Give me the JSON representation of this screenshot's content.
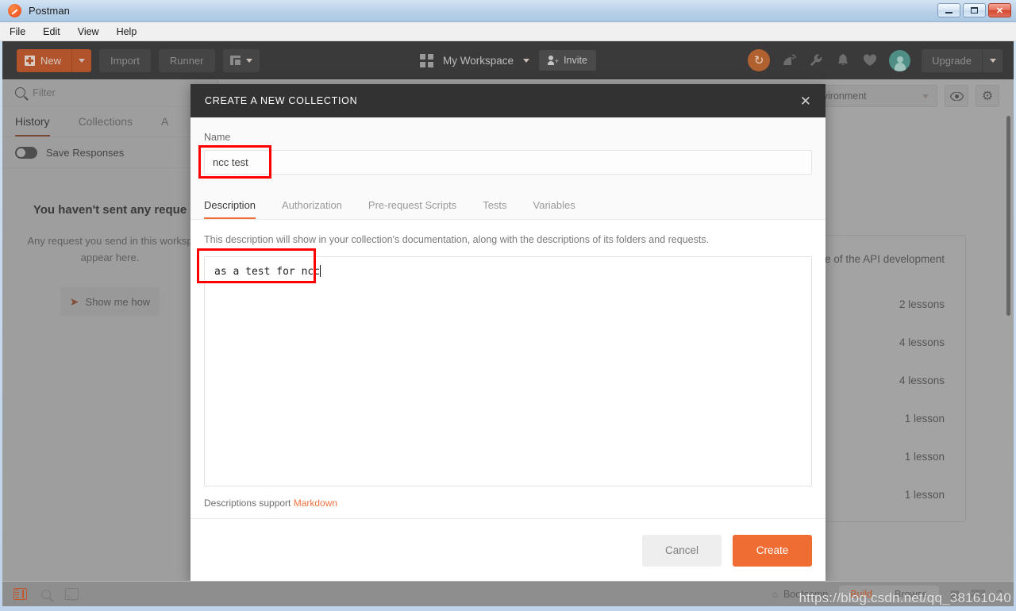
{
  "window": {
    "title": "Postman",
    "minimize_label": "—",
    "maximize_label": "□",
    "close_label": "✕"
  },
  "menubar": {
    "items": [
      "File",
      "Edit",
      "View",
      "Help"
    ]
  },
  "toolbar": {
    "new_label": "New",
    "import_label": "Import",
    "runner_label": "Runner",
    "workspace_label": "My Workspace",
    "invite_label": "Invite",
    "upgrade_label": "Upgrade",
    "icons": [
      "sync-icon",
      "broadcast-icon",
      "wrench-icon",
      "bell-icon",
      "heart-icon",
      "avatar-icon"
    ],
    "sync_glyph": "↻"
  },
  "sidebar": {
    "filter_placeholder": "Filter",
    "tabs": [
      {
        "label": "History",
        "active": true
      },
      {
        "label": "Collections",
        "active": false
      },
      {
        "label": "A",
        "active": false
      }
    ],
    "save_responses_label": "Save Responses",
    "empty_title": "You haven't sent any reque",
    "empty_sub_line1": "Any request you send in this worksp",
    "empty_sub_line2": "appear here.",
    "show_me_how_label": "Show me how",
    "cursor_glyph": "➤"
  },
  "right_pane": {
    "environment_selected": "No Environment",
    "environment_visible_text": "nment",
    "eye_glyph": "◉",
    "gear_glyph": "⚙",
    "card_line": "stage of the API development",
    "lessons": [
      "2 lessons",
      "4 lessons",
      "4 lessons",
      "1 lesson",
      "1 lesson",
      "1 lesson"
    ]
  },
  "modal": {
    "title": "CREATE A NEW COLLECTION",
    "close_glyph": "✕",
    "name_label": "Name",
    "name_value": "ncc test",
    "tabs": [
      {
        "label": "Description",
        "active": true
      },
      {
        "label": "Authorization",
        "active": false
      },
      {
        "label": "Pre-request Scripts",
        "active": false
      },
      {
        "label": "Tests",
        "active": false
      },
      {
        "label": "Variables",
        "active": false
      }
    ],
    "description_hint": "This description will show in your collection's documentation, along with the descriptions of its folders and requests.",
    "description_value": "as a test for ncc",
    "markdown_note_prefix": "Descriptions support ",
    "markdown_link": "Markdown",
    "cancel_label": "Cancel",
    "create_label": "Create"
  },
  "statusbar": {
    "bootcamp_label": "Bootcamp",
    "bootcamp_glyph": "⌂",
    "build_label": "Build",
    "browse_label": "Browse",
    "layout_glyph": "▦",
    "keyboard_glyph": "⌨",
    "help_glyph": "?",
    "console_glyph": ">_"
  },
  "watermark": {
    "text": "https://blog.csdn.net/qq_38161040"
  },
  "colors": {
    "accent_orange": "#ef6c33",
    "toolbar_dark": "#3a3a3a",
    "modal_header": "#323232",
    "annotation_red": "#fe0000",
    "new_button": "#b1532b"
  }
}
